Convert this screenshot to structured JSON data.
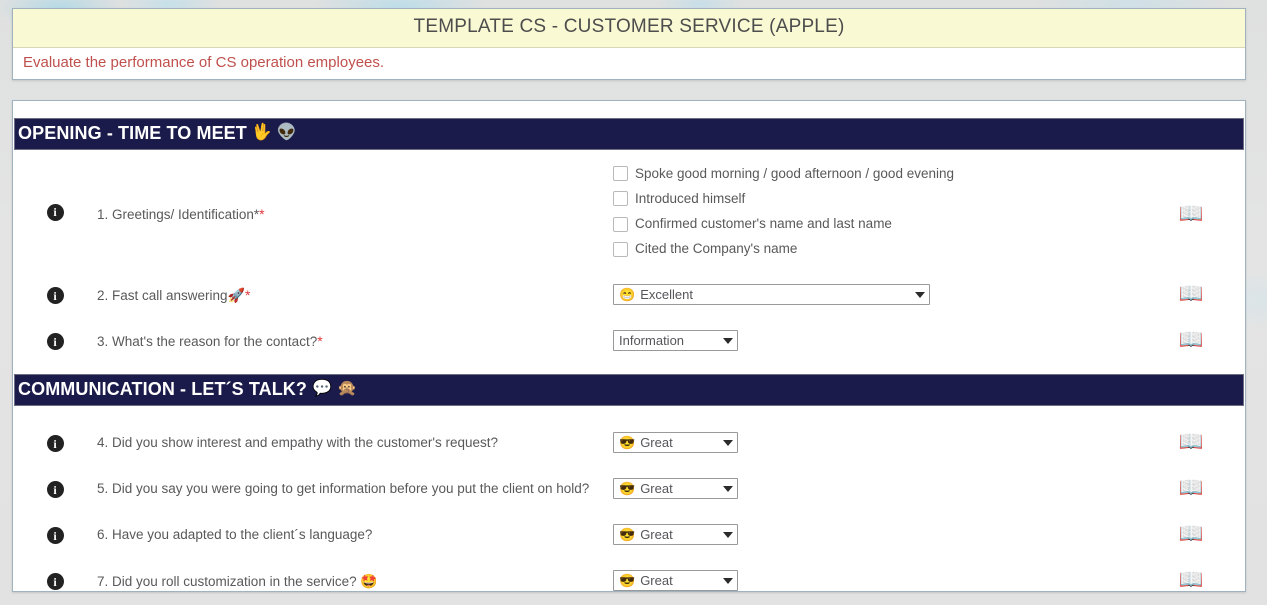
{
  "header": {
    "title": "TEMPLATE CS - CUSTOMER SERVICE (APPLE)",
    "subtitle": "Evaluate the performance of CS operation employees.",
    "title_bg": "#f9f9d4",
    "subtitle_color": "#c0504d"
  },
  "icons": {
    "info": "i",
    "book": "📖"
  },
  "sections": [
    {
      "title": "OPENING - TIME TO MEET",
      "emojis": [
        "🖖",
        "👽"
      ],
      "bar_color": "#1b1b4b",
      "questions": [
        {
          "number": "1.",
          "text": "1. Greetings/ Identification*",
          "required_mark": "*",
          "emoji": "",
          "control": "checkbox-group",
          "options": [
            "Spoke good morning / good afternoon / good evening",
            "Introduced himself",
            "Confirmed customer's name and last name",
            "Cited the Company's name"
          ],
          "checked": [
            false,
            false,
            false,
            false
          ]
        },
        {
          "number": "2.",
          "text": "2. Fast call answering",
          "required_mark": "*",
          "emoji": "🚀",
          "control": "select-wide",
          "value": "Excellent",
          "value_emoji": "😁"
        },
        {
          "number": "3.",
          "text": "3. What's the reason for the contact?",
          "required_mark": "*",
          "emoji": "",
          "control": "select-narrow",
          "value": "Information",
          "value_emoji": ""
        }
      ]
    },
    {
      "title": "COMMUNICATION - LET´S TALK?",
      "emojis": [
        "💬",
        "🙊"
      ],
      "bar_color": "#1b1b4b",
      "questions": [
        {
          "number": "4.",
          "text": "4. Did you show interest and empathy with the customer's request?",
          "required_mark": "",
          "emoji": "",
          "control": "select-narrow",
          "value": "Great",
          "value_emoji": "😎"
        },
        {
          "number": "5.",
          "text": "5. Did you say you were going to get information before you put the client on hold?",
          "required_mark": "",
          "emoji": "",
          "control": "select-narrow",
          "value": "Great",
          "value_emoji": "😎"
        },
        {
          "number": "6.",
          "text": "6. Have you adapted to the client´s language?",
          "required_mark": "",
          "emoji": "",
          "control": "select-narrow",
          "value": "Great",
          "value_emoji": "😎"
        },
        {
          "number": "7.",
          "text": "7. Did you roll customization in the service?",
          "required_mark": "",
          "emoji": "🤩",
          "control": "select-narrow",
          "value": "Great",
          "value_emoji": "😎"
        }
      ]
    }
  ]
}
